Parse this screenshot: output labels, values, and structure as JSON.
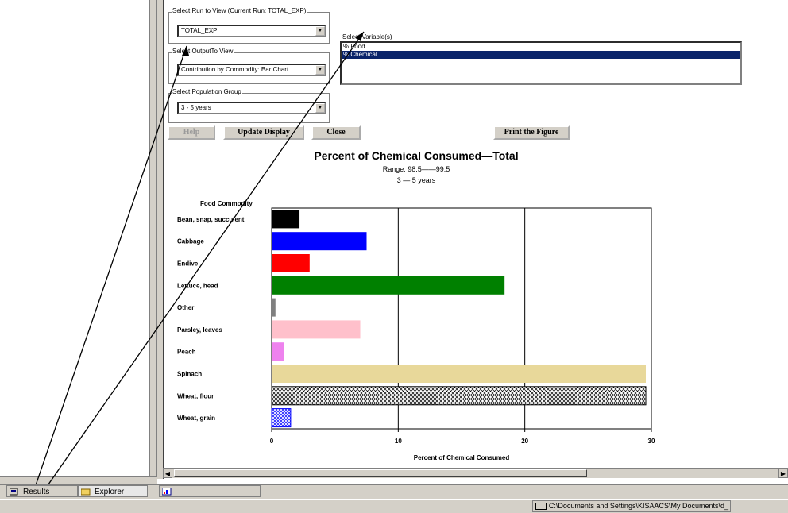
{
  "form": {
    "run_label": "Select Run to View (Current Run: TOTAL_EXP)",
    "run_value": "TOTAL_EXP",
    "output_label": "Select OutputTo View",
    "output_value": "Contribution by Commodity: Bar Chart",
    "pop_label": "Select Population Group",
    "pop_value": "3 - 5 years",
    "variable_label": "Select Variable(s)",
    "variables": [
      "% Food",
      "% Chemical"
    ],
    "selected_variable_index": 1
  },
  "buttons": {
    "help": "Help",
    "update": "Update Display",
    "close": "Close",
    "print": "Print the Figure"
  },
  "tabs": {
    "results": "Results",
    "explorer": "Explorer"
  },
  "status": {
    "path": "C:\\Documents and Settings\\KISAACS\\My Documents\\d_"
  },
  "chart_data": {
    "type": "bar",
    "orientation": "horizontal",
    "title": "Percent of Chemical Consumed—Total",
    "subtitle_range": "Range: 98.5——99.5",
    "subtitle_group": "3 — 5 years",
    "category_axis_label": "Food Commodity",
    "xlabel": "Percent of Chemical Consumed",
    "xlim": [
      0,
      30
    ],
    "ticks": [
      0,
      10,
      20,
      30
    ],
    "grid": true,
    "categories": [
      "Bean, snap, succulent",
      "Cabbage",
      "Endive",
      "Lettuce, head",
      "Other",
      "Parsley, leaves",
      "Peach",
      "Spinach",
      "Wheat, flour",
      "Wheat, grain"
    ],
    "values": [
      2.2,
      7.5,
      3.0,
      18.4,
      0.3,
      7.0,
      1.0,
      30.4,
      30.6,
      1.5
    ],
    "colors": [
      "#000000",
      "#0000ff",
      "#ff0000",
      "#008000",
      "#808080",
      "#ffc0cb",
      "#ee82ee",
      "#e8d89a",
      "crosshatch-black",
      "crosshatch-blue"
    ]
  }
}
